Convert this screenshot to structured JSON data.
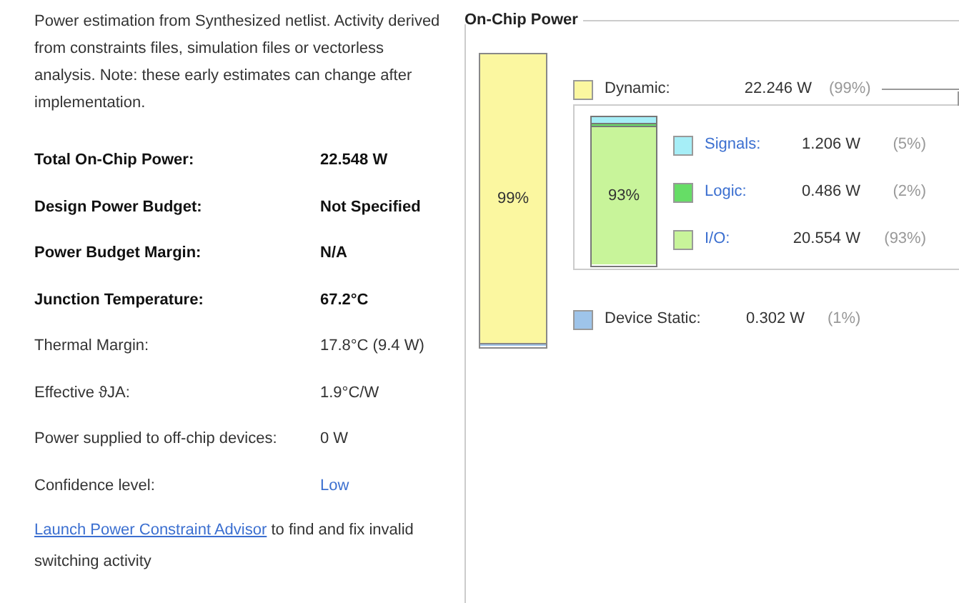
{
  "summary": {
    "description": "Power estimation from Synthesized netlist. Activity derived from constraints files, simulation files or vectorless analysis. Note: these early estimates can change after implementation.",
    "rows": [
      {
        "label": "Total On-Chip Power:",
        "value": "22.548 W",
        "bold": true,
        "kind": "plain"
      },
      {
        "label": "Design Power Budget:",
        "value": "Not Specified",
        "bold": true,
        "kind": "plain"
      },
      {
        "label": "Power Budget Margin:",
        "value": "N/A",
        "bold": true,
        "kind": "plain"
      },
      {
        "label": "Junction Temperature:",
        "value": "67.2°C",
        "bold": true,
        "kind": "plain"
      },
      {
        "label": "Thermal Margin:",
        "value": "17.8°C (9.4 W)",
        "bold": false,
        "kind": "plain"
      },
      {
        "label": "Effective ϑJA:",
        "value": "1.9°C/W",
        "bold": false,
        "kind": "plain"
      },
      {
        "label": "Power supplied to off-chip devices:",
        "value": "0 W",
        "bold": false,
        "kind": "plain"
      },
      {
        "label": "Confidence level:",
        "value": "Low",
        "bold": false,
        "kind": "link"
      }
    ],
    "advisor": {
      "link": "Launch Power Constraint Advisor",
      "text": "to find and fix invalid switching activity"
    }
  },
  "on_chip_power": {
    "title": "On-Chip Power",
    "bar_label": "99%",
    "dynamic": {
      "label": "Dynamic:",
      "value": "22.246 W",
      "percent": "(99%)",
      "color": "#fbf7a0",
      "level": 0.99,
      "bar_label": "93%",
      "children": [
        {
          "label": "Signals:",
          "value": "1.206 W",
          "percent": "(5%)",
          "color": "#a6eef7",
          "level": 0.05
        },
        {
          "label": "Logic:",
          "value": "0.486 W",
          "percent": "(2%)",
          "color": "#66dd66",
          "level": 0.02
        },
        {
          "label": "I/O:",
          "value": "20.554 W",
          "percent": "(93%)",
          "color": "#c8f49a",
          "level": 0.93
        }
      ]
    },
    "static": {
      "label": "Device Static:",
      "value": "0.302 W",
      "percent": "(1%)",
      "color": "#9ec4ea",
      "level": 0.01
    }
  }
}
